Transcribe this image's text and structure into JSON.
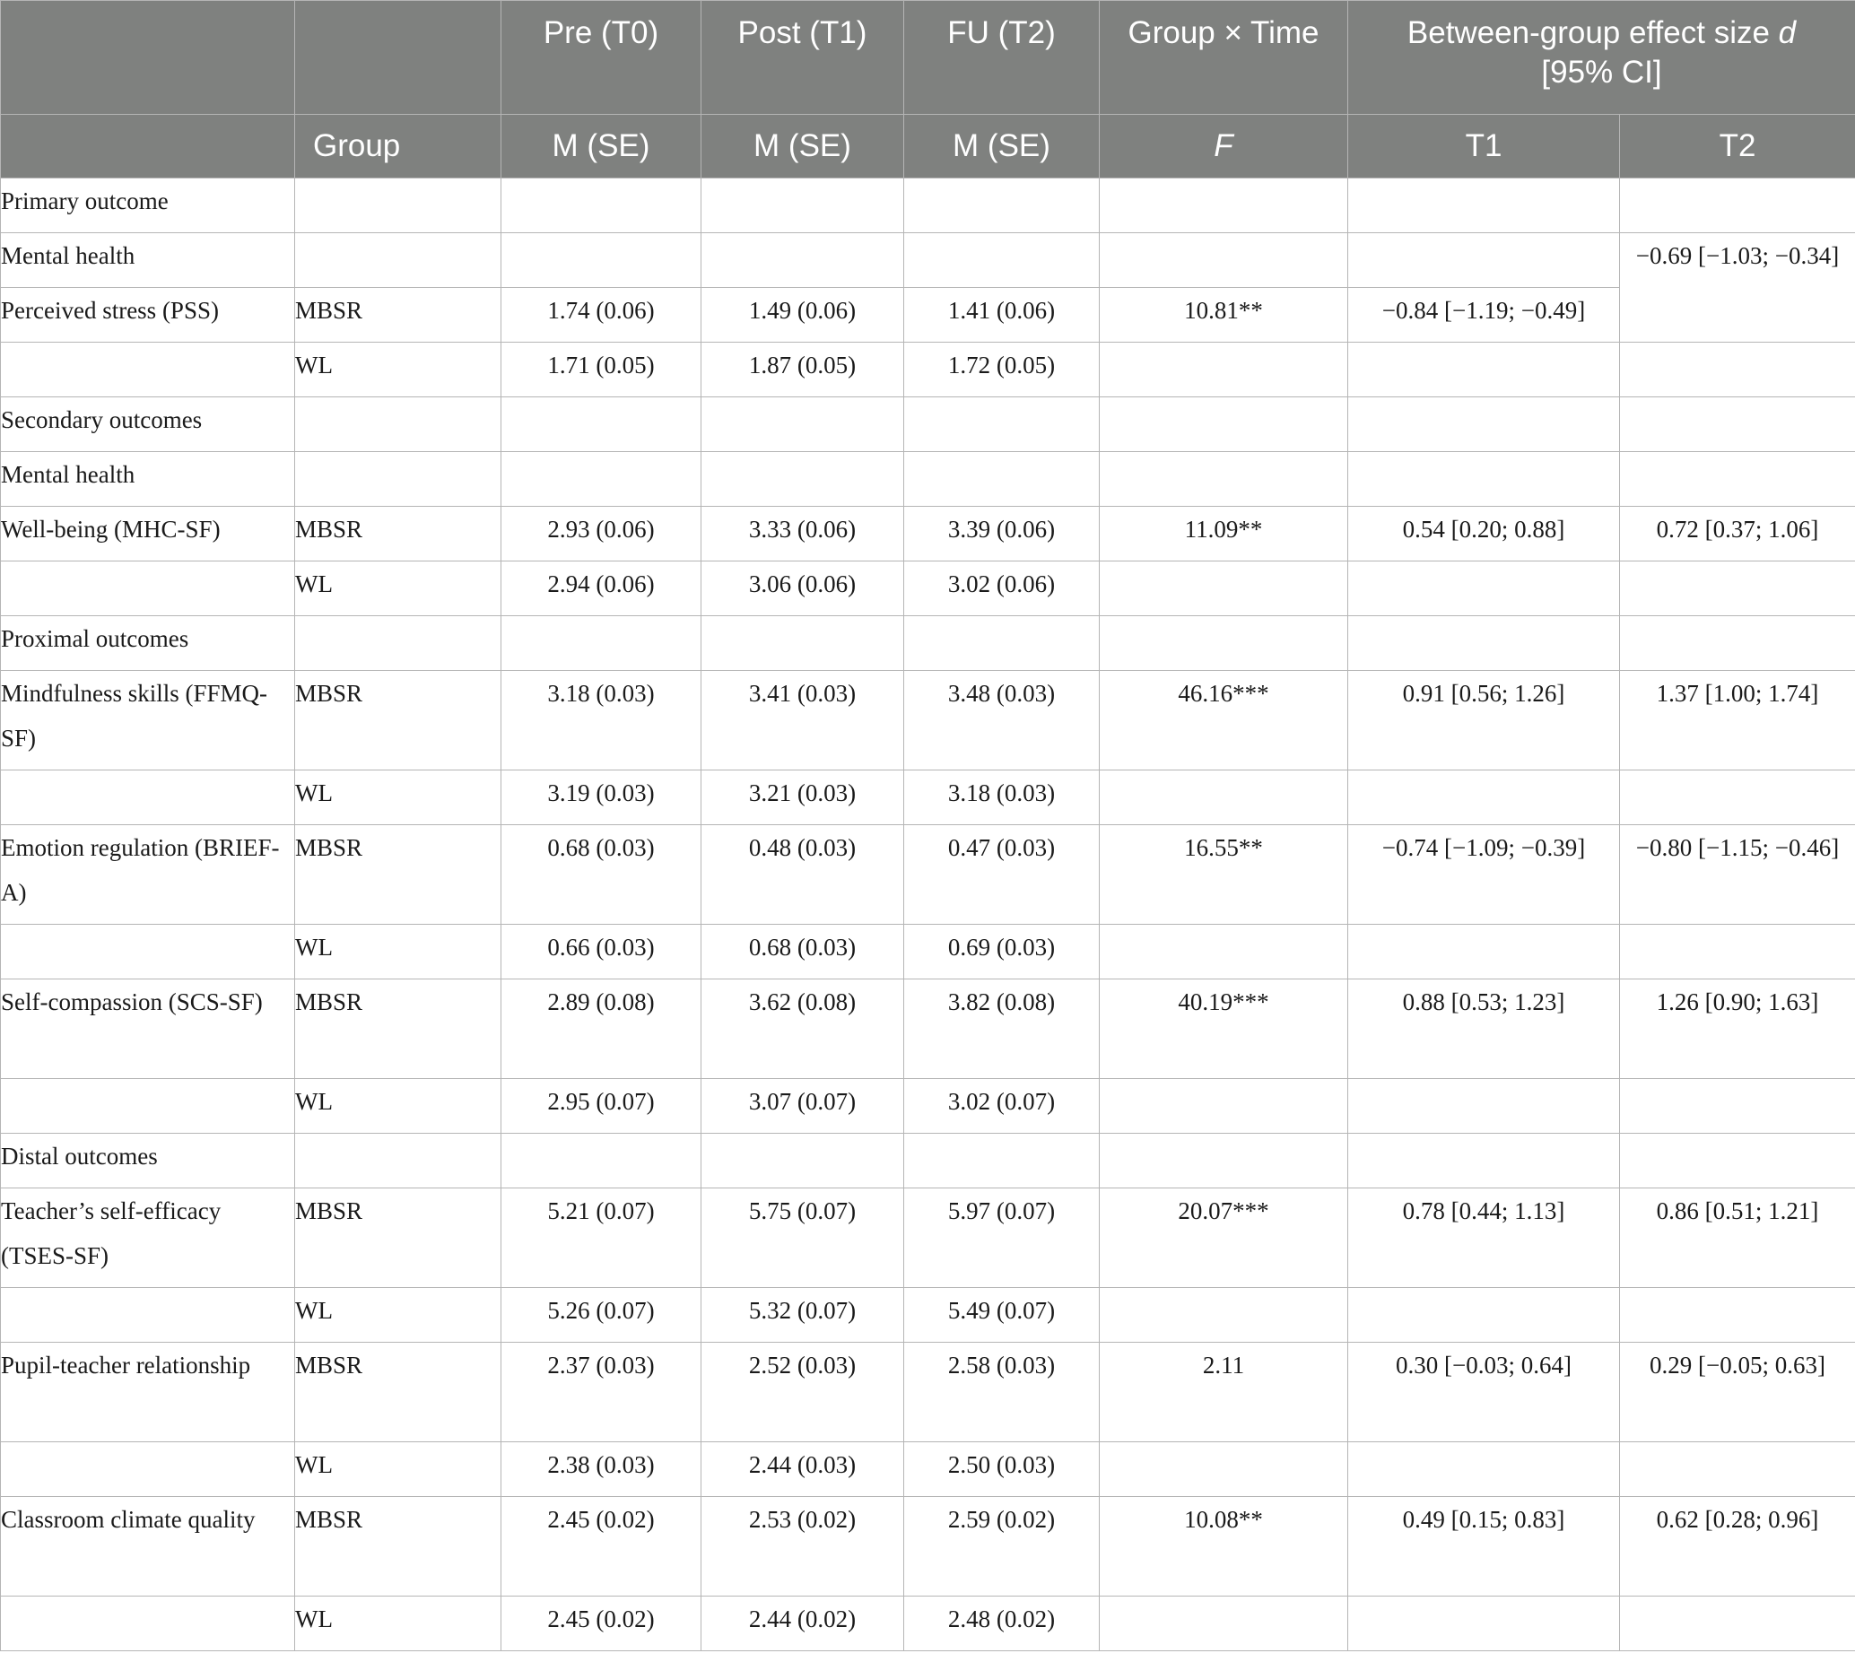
{
  "header": {
    "row1": [
      "",
      "",
      "Pre (T0)",
      "Post (T1)",
      "FU (T2)",
      "Group × Time",
      "Between-group effect size d [95% CI]"
    ],
    "effect_title_main": "Between-group effect size ",
    "effect_title_italic": "d",
    "effect_title_ci": "[95% CI]",
    "row2": [
      "",
      "Group",
      "M (SE)",
      "M (SE)",
      "M (SE)",
      "F",
      "T1",
      "T2"
    ]
  },
  "rows": [
    {
      "outcome": "Primary outcome",
      "group": "",
      "pre": "",
      "post": "",
      "fu": "",
      "f": "",
      "t1": "",
      "t2": ""
    },
    {
      "outcome": "Mental health",
      "group": "",
      "pre": "",
      "post": "",
      "fu": "",
      "f": "",
      "t1": "",
      "t2": "−0.69 [−1.03; −0.34]"
    },
    {
      "outcome": "Perceived stress (PSS)",
      "group": "MBSR",
      "pre": "1.74 (0.06)",
      "post": "1.49 (0.06)",
      "fu": "1.41 (0.06)",
      "f": "10.81**",
      "t1": "−0.84 [−1.19; −0.49]",
      "t2": ""
    },
    {
      "outcome": "",
      "group": "WL",
      "pre": "1.71 (0.05)",
      "post": "1.87 (0.05)",
      "fu": "1.72 (0.05)",
      "f": "",
      "t1": "",
      "t2": ""
    },
    {
      "outcome": "Secondary outcomes",
      "group": "",
      "pre": "",
      "post": "",
      "fu": "",
      "f": "",
      "t1": "",
      "t2": ""
    },
    {
      "outcome": "Mental health",
      "group": "",
      "pre": "",
      "post": "",
      "fu": "",
      "f": "",
      "t1": "",
      "t2": ""
    },
    {
      "outcome": "Well-being (MHC-SF)",
      "group": "MBSR",
      "pre": "2.93 (0.06)",
      "post": "3.33 (0.06)",
      "fu": "3.39 (0.06)",
      "f": "11.09**",
      "t1": "0.54 [0.20; 0.88]",
      "t2": "0.72 [0.37; 1.06]"
    },
    {
      "outcome": "",
      "group": "WL",
      "pre": "2.94 (0.06)",
      "post": "3.06 (0.06)",
      "fu": "3.02 (0.06)",
      "f": "",
      "t1": "",
      "t2": ""
    },
    {
      "outcome": "Proximal outcomes",
      "group": "",
      "pre": "",
      "post": "",
      "fu": "",
      "f": "",
      "t1": "",
      "t2": ""
    },
    {
      "outcome": "Mindfulness skills (FFMQ-SF)",
      "group": "MBSR",
      "pre": "3.18 (0.03)",
      "post": "3.41 (0.03)",
      "fu": "3.48 (0.03)",
      "f": "46.16***",
      "t1": "0.91 [0.56; 1.26]",
      "t2": "1.37 [1.00; 1.74]"
    },
    {
      "outcome": "",
      "group": "WL",
      "pre": "3.19 (0.03)",
      "post": "3.21 (0.03)",
      "fu": "3.18 (0.03)",
      "f": "",
      "t1": "",
      "t2": ""
    },
    {
      "outcome": "Emotion regulation (BRIEF-A)",
      "group": "MBSR",
      "pre": "0.68 (0.03)",
      "post": "0.48 (0.03)",
      "fu": "0.47 (0.03)",
      "f": "16.55**",
      "t1": "−0.74 [−1.09; −0.39]",
      "t2": "−0.80 [−1.15; −0.46]"
    },
    {
      "outcome": "",
      "group": "WL",
      "pre": "0.66 (0.03)",
      "post": "0.68 (0.03)",
      "fu": "0.69 (0.03)",
      "f": "",
      "t1": "",
      "t2": ""
    },
    {
      "outcome": "Self-compassion (SCS-SF)",
      "group": "MBSR",
      "pre": "2.89 (0.08)",
      "post": "3.62 (0.08)",
      "fu": "3.82 (0.08)",
      "f": "40.19***",
      "t1": "0.88 [0.53; 1.23]",
      "t2": "1.26 [0.90; 1.63]"
    },
    {
      "outcome": "",
      "group": "WL",
      "pre": "2.95 (0.07)",
      "post": "3.07 (0.07)",
      "fu": "3.02 (0.07)",
      "f": "",
      "t1": "",
      "t2": ""
    },
    {
      "outcome": "Distal outcomes",
      "group": "",
      "pre": "",
      "post": "",
      "fu": "",
      "f": "",
      "t1": "",
      "t2": ""
    },
    {
      "outcome": "Teacher’s self-efficacy (TSES-SF)",
      "group": "MBSR",
      "pre": "5.21 (0.07)",
      "post": "5.75 (0.07)",
      "fu": "5.97 (0.07)",
      "f": "20.07***",
      "t1": "0.78 [0.44; 1.13]",
      "t2": "0.86 [0.51; 1.21]"
    },
    {
      "outcome": "",
      "group": "WL",
      "pre": "5.26 (0.07)",
      "post": "5.32 (0.07)",
      "fu": "5.49 (0.07)",
      "f": "",
      "t1": "",
      "t2": ""
    },
    {
      "outcome": "Pupil-teacher relationship",
      "group": "MBSR",
      "pre": "2.37 (0.03)",
      "post": "2.52 (0.03)",
      "fu": "2.58 (0.03)",
      "f": "2.11",
      "t1": "0.30 [−0.03; 0.64]",
      "t2": "0.29 [−0.05; 0.63]"
    },
    {
      "outcome": "",
      "group": "WL",
      "pre": "2.38 (0.03)",
      "post": "2.44 (0.03)",
      "fu": "2.50 (0.03)",
      "f": "",
      "t1": "",
      "t2": ""
    },
    {
      "outcome": "Classroom climate quality",
      "group": "MBSR",
      "pre": "2.45 (0.02)",
      "post": "2.53 (0.02)",
      "fu": "2.59 (0.02)",
      "f": "10.08**",
      "t1": "0.49 [0.15; 0.83]",
      "t2": "0.62 [0.28; 0.96]"
    },
    {
      "outcome": "",
      "group": "WL",
      "pre": "2.45 (0.02)",
      "post": "2.44 (0.02)",
      "fu": "2.48 (0.02)",
      "f": "",
      "t1": "",
      "t2": ""
    }
  ]
}
